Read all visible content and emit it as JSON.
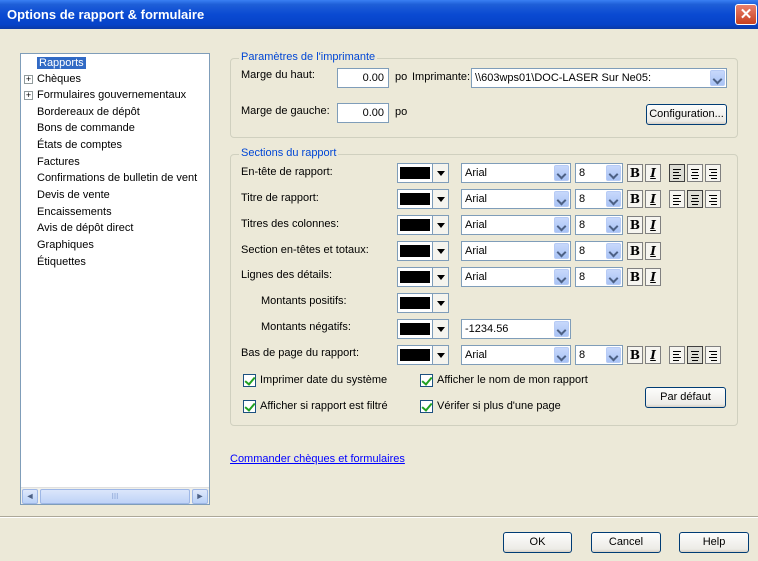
{
  "window": {
    "title": "Options de rapport & formulaire",
    "close_glyph": "✕"
  },
  "tree": {
    "items": [
      {
        "label": "Rapports",
        "expandable": false,
        "selected": true
      },
      {
        "label": "Chèques",
        "expandable": true
      },
      {
        "label": "Formulaires gouvernementaux",
        "expandable": true
      },
      {
        "label": "Bordereaux de dépôt"
      },
      {
        "label": "Bons de commande"
      },
      {
        "label": "États de comptes"
      },
      {
        "label": "Factures"
      },
      {
        "label": "Confirmations de bulletin de vent"
      },
      {
        "label": "Devis de vente"
      },
      {
        "label": "Encaissements"
      },
      {
        "label": "Avis de dépôt direct"
      },
      {
        "label": "Graphiques"
      },
      {
        "label": "Étiquettes"
      }
    ],
    "expander_glyph": "+",
    "scroll_left": "◄",
    "scroll_right": "►",
    "scroll_grip": "III"
  },
  "printer": {
    "title": "Paramètres de l'imprimante",
    "top_margin_label": "Marge du haut:",
    "top_margin_value": "0.00",
    "left_margin_label": "Marge de gauche:",
    "left_margin_value": "0.00",
    "unit": "po",
    "printer_label": "Imprimante:",
    "printer_value": "\\\\603wps01\\DOC-LASER Sur Ne05:",
    "config_button": "Configuration..."
  },
  "sections": {
    "title": "Sections du rapport",
    "rows": [
      {
        "label": "En-tête de rapport:",
        "font": "Arial",
        "size": "8"
      },
      {
        "label": "Titre de rapport:",
        "font": "Arial",
        "size": "8"
      },
      {
        "label": "Titres des colonnes:",
        "font": "Arial",
        "size": "8"
      },
      {
        "label": "Section en-têtes et totaux:",
        "font": "Arial",
        "size": "8"
      },
      {
        "label": "Lignes des détails:",
        "font": "Arial",
        "size": "8"
      },
      {
        "label": "Montants positifs:"
      },
      {
        "label": "Montants négatifs:",
        "format": "-1234.56"
      },
      {
        "label": "Bas de page du rapport:",
        "font": "Arial",
        "size": "8"
      }
    ],
    "bold_glyph": "B",
    "italic_glyph": "I",
    "checkboxes": [
      {
        "label": "Imprimer date du système",
        "checked": true
      },
      {
        "label": "Afficher le nom de mon rapport",
        "checked": true
      },
      {
        "label": "Afficher si rapport est filtré",
        "checked": true
      },
      {
        "label": "Vérifer si plus d'une page",
        "checked": true
      }
    ],
    "default_button": "Par défaut"
  },
  "link": "Commander chèques et formulaires",
  "footer": {
    "ok": "OK",
    "cancel": "Cancel",
    "help": "Help"
  },
  "colors": {
    "title_bar": "#0a4ad2",
    "selection": "#316ac5",
    "group_title": "#0046d5",
    "link": "#0000ff"
  }
}
